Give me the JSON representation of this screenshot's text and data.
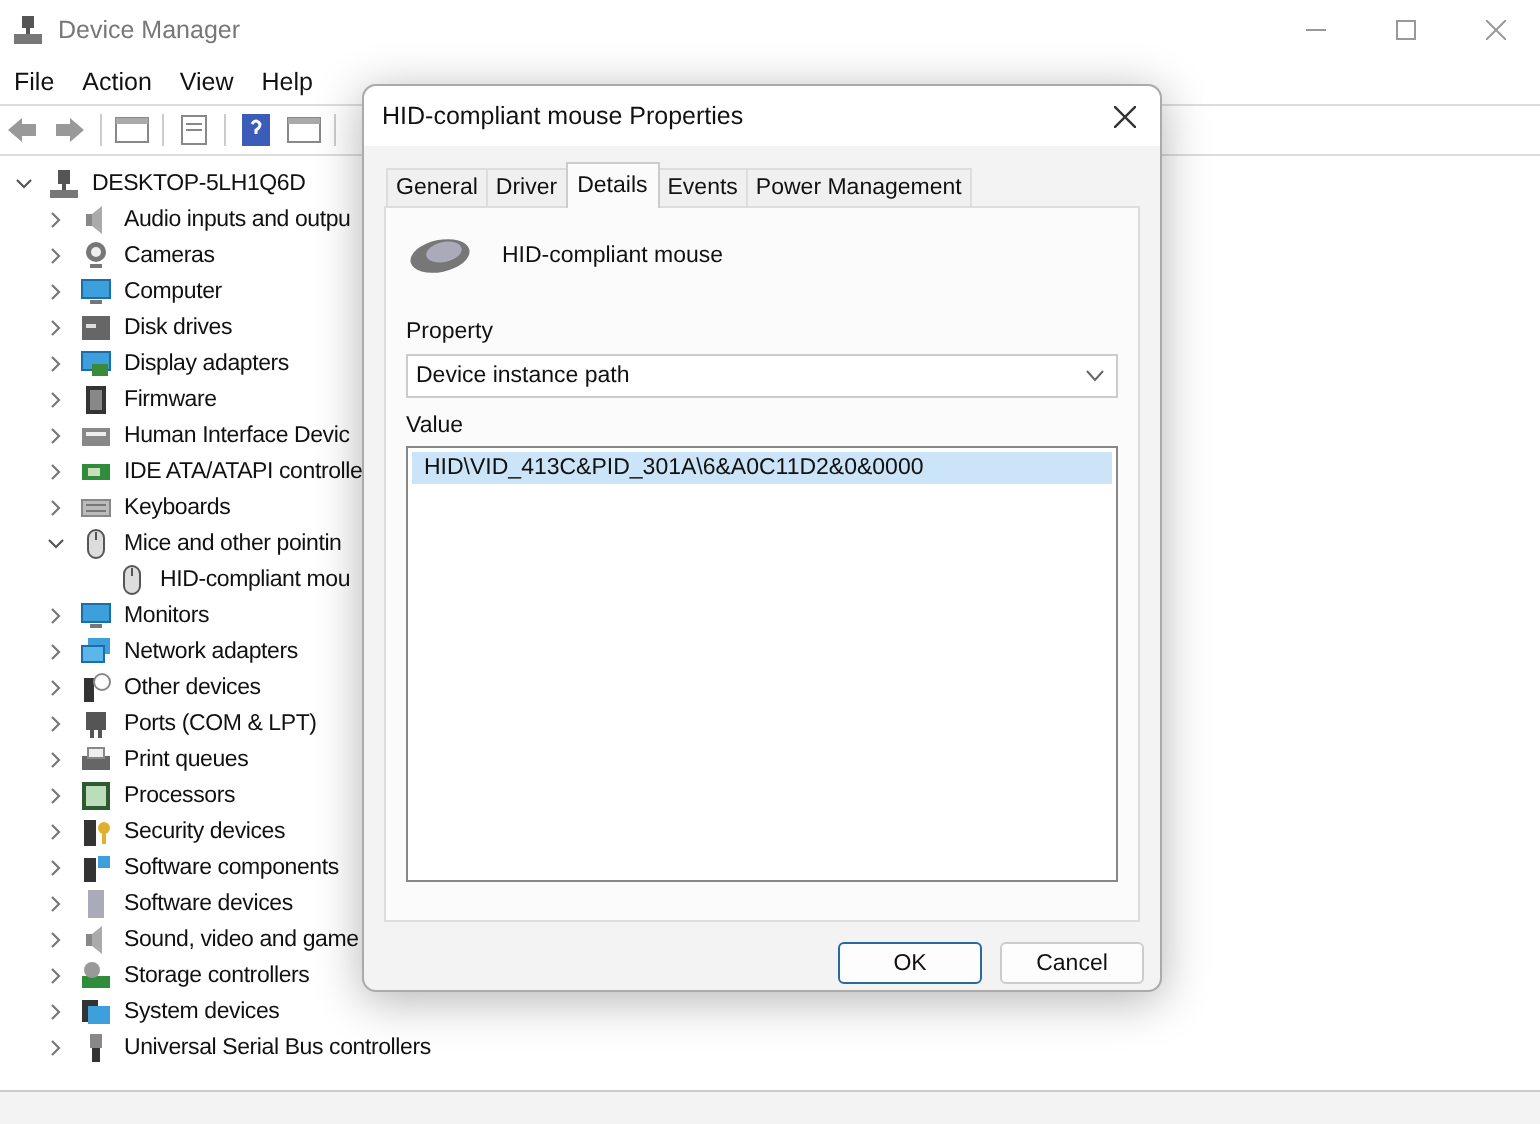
{
  "window": {
    "title": "Device Manager"
  },
  "menu": [
    "File",
    "Action",
    "View",
    "Help"
  ],
  "tree": {
    "label": "DESKTOP-5LH1Q6D",
    "expanded": true,
    "children": [
      {
        "label": "Audio inputs and outpu",
        "expanded": false
      },
      {
        "label": "Cameras",
        "expanded": false
      },
      {
        "label": "Computer",
        "expanded": false
      },
      {
        "label": "Disk drives",
        "expanded": false
      },
      {
        "label": "Display adapters",
        "expanded": false
      },
      {
        "label": "Firmware",
        "expanded": false
      },
      {
        "label": "Human Interface Devic",
        "expanded": false
      },
      {
        "label": "IDE ATA/ATAPI controlle",
        "expanded": false
      },
      {
        "label": "Keyboards",
        "expanded": false
      },
      {
        "label": "Mice and other pointin",
        "expanded": true,
        "children": [
          {
            "label": "HID-compliant mou"
          }
        ]
      },
      {
        "label": "Monitors",
        "expanded": false
      },
      {
        "label": "Network adapters",
        "expanded": false
      },
      {
        "label": "Other devices",
        "expanded": false
      },
      {
        "label": "Ports (COM & LPT)",
        "expanded": false
      },
      {
        "label": "Print queues",
        "expanded": false
      },
      {
        "label": "Processors",
        "expanded": false
      },
      {
        "label": "Security devices",
        "expanded": false
      },
      {
        "label": "Software components",
        "expanded": false
      },
      {
        "label": "Software devices",
        "expanded": false
      },
      {
        "label": "Sound, video and game",
        "expanded": false
      },
      {
        "label": "Storage controllers",
        "expanded": false
      },
      {
        "label": "System devices",
        "expanded": false
      },
      {
        "label": "Universal Serial Bus controllers",
        "expanded": false
      }
    ]
  },
  "dialog": {
    "title": "HID-compliant mouse Properties",
    "tabs": [
      {
        "label": "General",
        "selected": false
      },
      {
        "label": "Driver",
        "selected": false
      },
      {
        "label": "Details",
        "selected": true
      },
      {
        "label": "Events",
        "selected": false
      },
      {
        "label": "Power Management",
        "selected": false
      }
    ],
    "device_name": "HID-compliant mouse",
    "property_label": "Property",
    "property_value": "Device instance path",
    "value_label": "Value",
    "values": [
      {
        "text": "HID\\VID_413C&PID_301A\\6&A0C11D2&0&0000",
        "selected": true
      }
    ],
    "buttons": [
      {
        "label": "OK",
        "default": true
      },
      {
        "label": "Cancel",
        "default": false
      }
    ]
  }
}
